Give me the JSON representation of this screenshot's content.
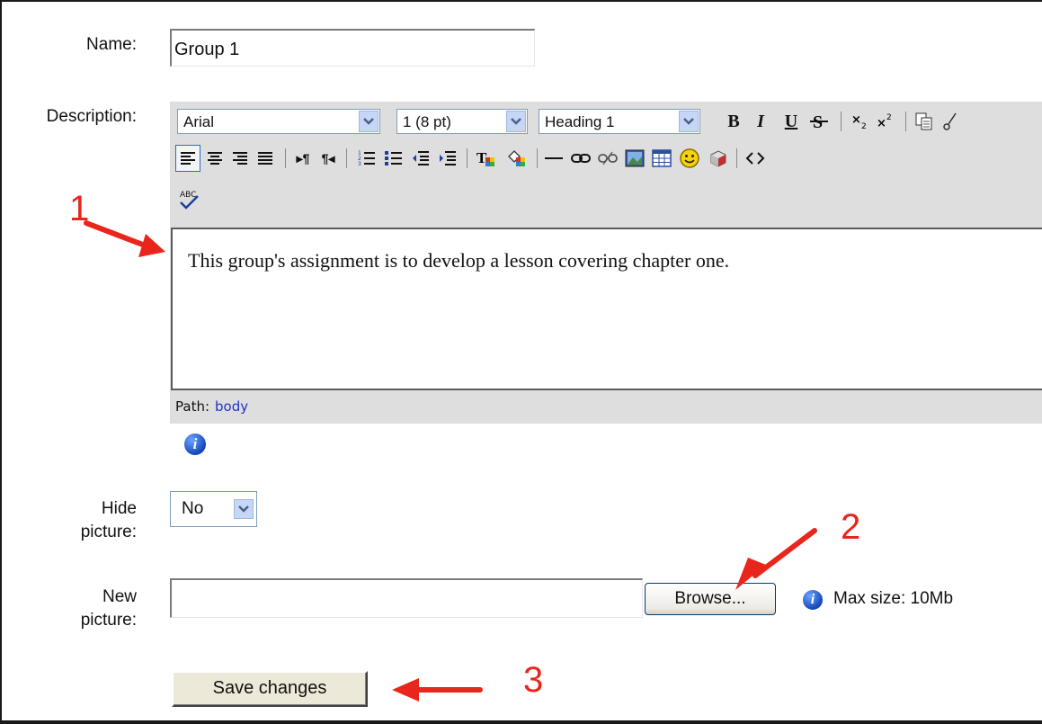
{
  "form": {
    "name_label": "Name:",
    "name_value": "Group 1",
    "description_label": "Description:",
    "hide_picture_label_1": "Hide",
    "hide_picture_label_2": "picture:",
    "hide_picture_value": "No",
    "new_picture_label_1": "New",
    "new_picture_label_2": "picture:",
    "browse_label": "Browse...",
    "max_size_text": "Max size: 10Mb",
    "save_label": "Save changes"
  },
  "editor": {
    "font_value": "Arial",
    "size_value": "1 (8 pt)",
    "format_value": "Heading 1",
    "content": "This group's assignment is to develop a lesson covering chapter one.",
    "path_label": "Path:",
    "path_value": "body"
  },
  "annotations": {
    "step1": "1",
    "step2": "2",
    "step3": "3",
    "color": "#e8261b"
  },
  "colors": {
    "toolbar_bg": "#dedede",
    "path_link": "#1d33c9",
    "info_icon": "#1446b8"
  }
}
